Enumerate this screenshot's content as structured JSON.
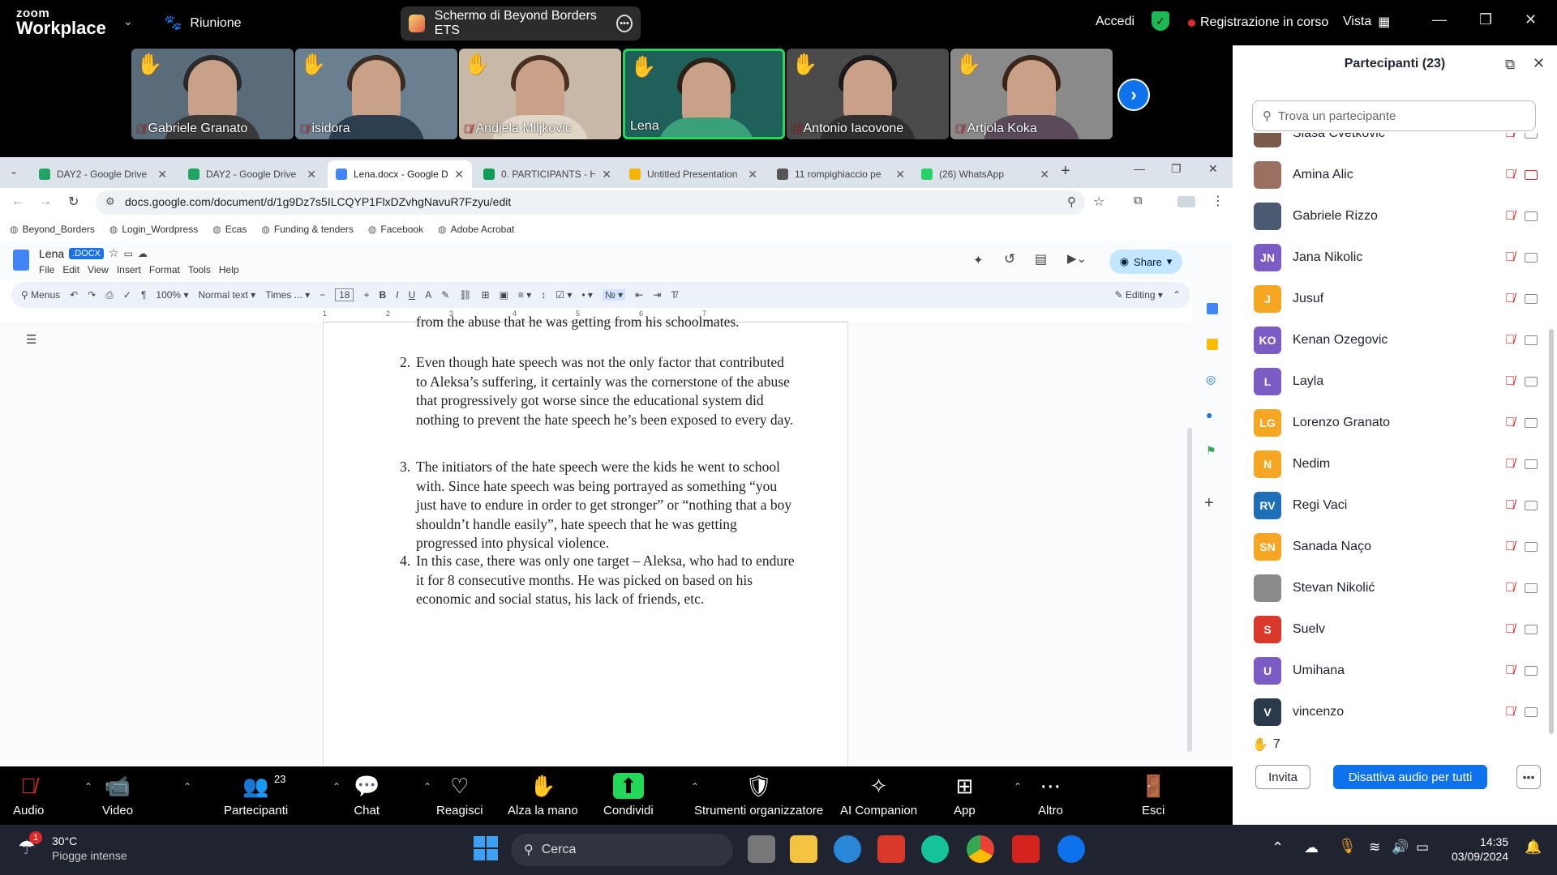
{
  "zoom": {
    "logo_top": "zoom",
    "logo_bottom": "Workplace",
    "meeting_label": "Riunione",
    "share_label": "Schermo di Beyond Borders ETS",
    "signin": "Accedi",
    "recording": "Registrazione in corso",
    "view": "Vista"
  },
  "thumbnails": [
    {
      "name": "Gabriele Granato",
      "muted": true,
      "hand": true
    },
    {
      "name": "isidora",
      "muted": true,
      "hand": true
    },
    {
      "name": "Andjela Miljkovic",
      "muted": true,
      "hand": true
    },
    {
      "name": "Lena",
      "muted": false,
      "hand": true,
      "active": true
    },
    {
      "name": "Antonio Iacovone",
      "muted": true,
      "hand": true
    },
    {
      "name": "Artjola Koka",
      "muted": true,
      "hand": true
    }
  ],
  "browser": {
    "tabs": [
      {
        "title": "DAY2 - Google Drive",
        "color": "#1fa463"
      },
      {
        "title": "DAY2 - Google Drive",
        "color": "#1fa463"
      },
      {
        "title": "Lena.docx - Google D",
        "color": "#4285f4",
        "active": true
      },
      {
        "title": "0. PARTICIPANTS - H",
        "color": "#0f9d58"
      },
      {
        "title": "Untitled Presentation",
        "color": "#f4b400"
      },
      {
        "title": "11 rompighiaccio pe",
        "color": "#555555"
      },
      {
        "title": "(26) WhatsApp",
        "color": "#25d366"
      }
    ],
    "url": "docs.google.com/document/d/1g9Dz7s5ILCQYP1FlxDZvhgNavuR7Fzyu/edit",
    "bookmarks": [
      "Beyond_Borders",
      "Login_Wordpress",
      "Ecas",
      "Funding & tenders",
      "Facebook",
      "Adobe Acrobat"
    ]
  },
  "doc": {
    "name": "Lena",
    "badge": ".DOCX",
    "menus": [
      "File",
      "Edit",
      "View",
      "Insert",
      "Format",
      "Tools",
      "Help"
    ],
    "share": "Share",
    "toolbar": {
      "menus": "Menus",
      "zoom": "100%",
      "style": "Normal text",
      "font": "Times ...",
      "size": "18",
      "mode": "Editing"
    },
    "top_line": "from the abuse that he was getting from his schoolmates.",
    "items": [
      {
        "num": "2.",
        "text": "Even though hate speech was not the only factor that contributed to Aleksa’s suffering, it certainly was the cornerstone of the abuse that progressively got worse since the educational system did nothing to prevent the hate speech he’s been exposed to every day."
      },
      {
        "num": "3.",
        "text": "The initiators of the hate speech were the kids he went to school with. Since hate speech was being portrayed as something “you just have to endure in order to get stronger” or “nothing that a boy shouldn’t handle easily”, hate speech that he was getting progressed into physical violence."
      },
      {
        "num": "4.",
        "text": "In this case, there was only one target – Aleksa, who had to endure it for 8 consecutive months. He was picked on based on his economic and social status, his lack of friends, etc."
      }
    ]
  },
  "participants": {
    "title": "Partecipanti (23)",
    "search_placeholder": "Trova un partecipante",
    "list": [
      {
        "name": "Slaša Cvetković",
        "initials": "",
        "color": "#7a5a48",
        "cam_off": false
      },
      {
        "name": "Amina Alic",
        "initials": "",
        "color": "#9a7060",
        "cam_off": true
      },
      {
        "name": "Gabriele Rizzo",
        "initials": "",
        "color": "#4a5a70",
        "cam_off": false
      },
      {
        "name": "Jana Nikolic",
        "initials": "JN",
        "color": "#7b5cc4",
        "cam_off": false
      },
      {
        "name": "Jusuf",
        "initials": "J",
        "color": "#f5a623",
        "cam_off": false
      },
      {
        "name": "Kenan Ozegovic",
        "initials": "KO",
        "color": "#7b5cc4",
        "cam_off": false
      },
      {
        "name": "Layla",
        "initials": "L",
        "color": "#7b5cc4",
        "cam_off": false
      },
      {
        "name": "Lorenzo Granato",
        "initials": "LG",
        "color": "#f5a623",
        "cam_off": false
      },
      {
        "name": "Nedim",
        "initials": "N",
        "color": "#f5a623",
        "cam_off": false
      },
      {
        "name": "Regi Vaci",
        "initials": "RV",
        "color": "#1f6fb8",
        "cam_off": false
      },
      {
        "name": "Sanada Naço",
        "initials": "SN",
        "color": "#f5a623",
        "cam_off": false
      },
      {
        "name": "Stevan Nikolić",
        "initials": "",
        "color": "#8a8a8a",
        "cam_off": false
      },
      {
        "name": "Suelv",
        "initials": "S",
        "color": "#d9382b",
        "cam_off": false
      },
      {
        "name": "Umihana",
        "initials": "U",
        "color": "#7b5cc4",
        "cam_off": false
      },
      {
        "name": "vincenzo",
        "initials": "V",
        "color": "#2b3a4a",
        "cam_off": false
      }
    ],
    "raised_hands": "7",
    "invite": "Invita",
    "mute_all": "Disattiva audio per tutti"
  },
  "controls": [
    {
      "label": "Audio",
      "icon": "mic-off-icon"
    },
    {
      "label": "Video",
      "icon": "video-icon"
    },
    {
      "label": "Partecipanti",
      "icon": "participants-icon",
      "count": "23"
    },
    {
      "label": "Chat",
      "icon": "chat-icon"
    },
    {
      "label": "Reagisci",
      "icon": "heart-icon"
    },
    {
      "label": "Alza la mano",
      "icon": "hand-icon"
    },
    {
      "label": "Condividi",
      "icon": "share-screen-icon"
    },
    {
      "label": "Strumenti organizzatore",
      "icon": "shield-icon"
    },
    {
      "label": "AI Companion",
      "icon": "sparkle-icon"
    },
    {
      "label": "App",
      "icon": "apps-icon"
    },
    {
      "label": "Altro",
      "icon": "more-icon"
    },
    {
      "label": "Esci",
      "icon": "exit-icon"
    }
  ],
  "taskbar": {
    "temp": "30°C",
    "weather": "Piogge intense",
    "badge": "1",
    "search": "Cerca",
    "time": "14:35",
    "date": "03/09/2024"
  }
}
